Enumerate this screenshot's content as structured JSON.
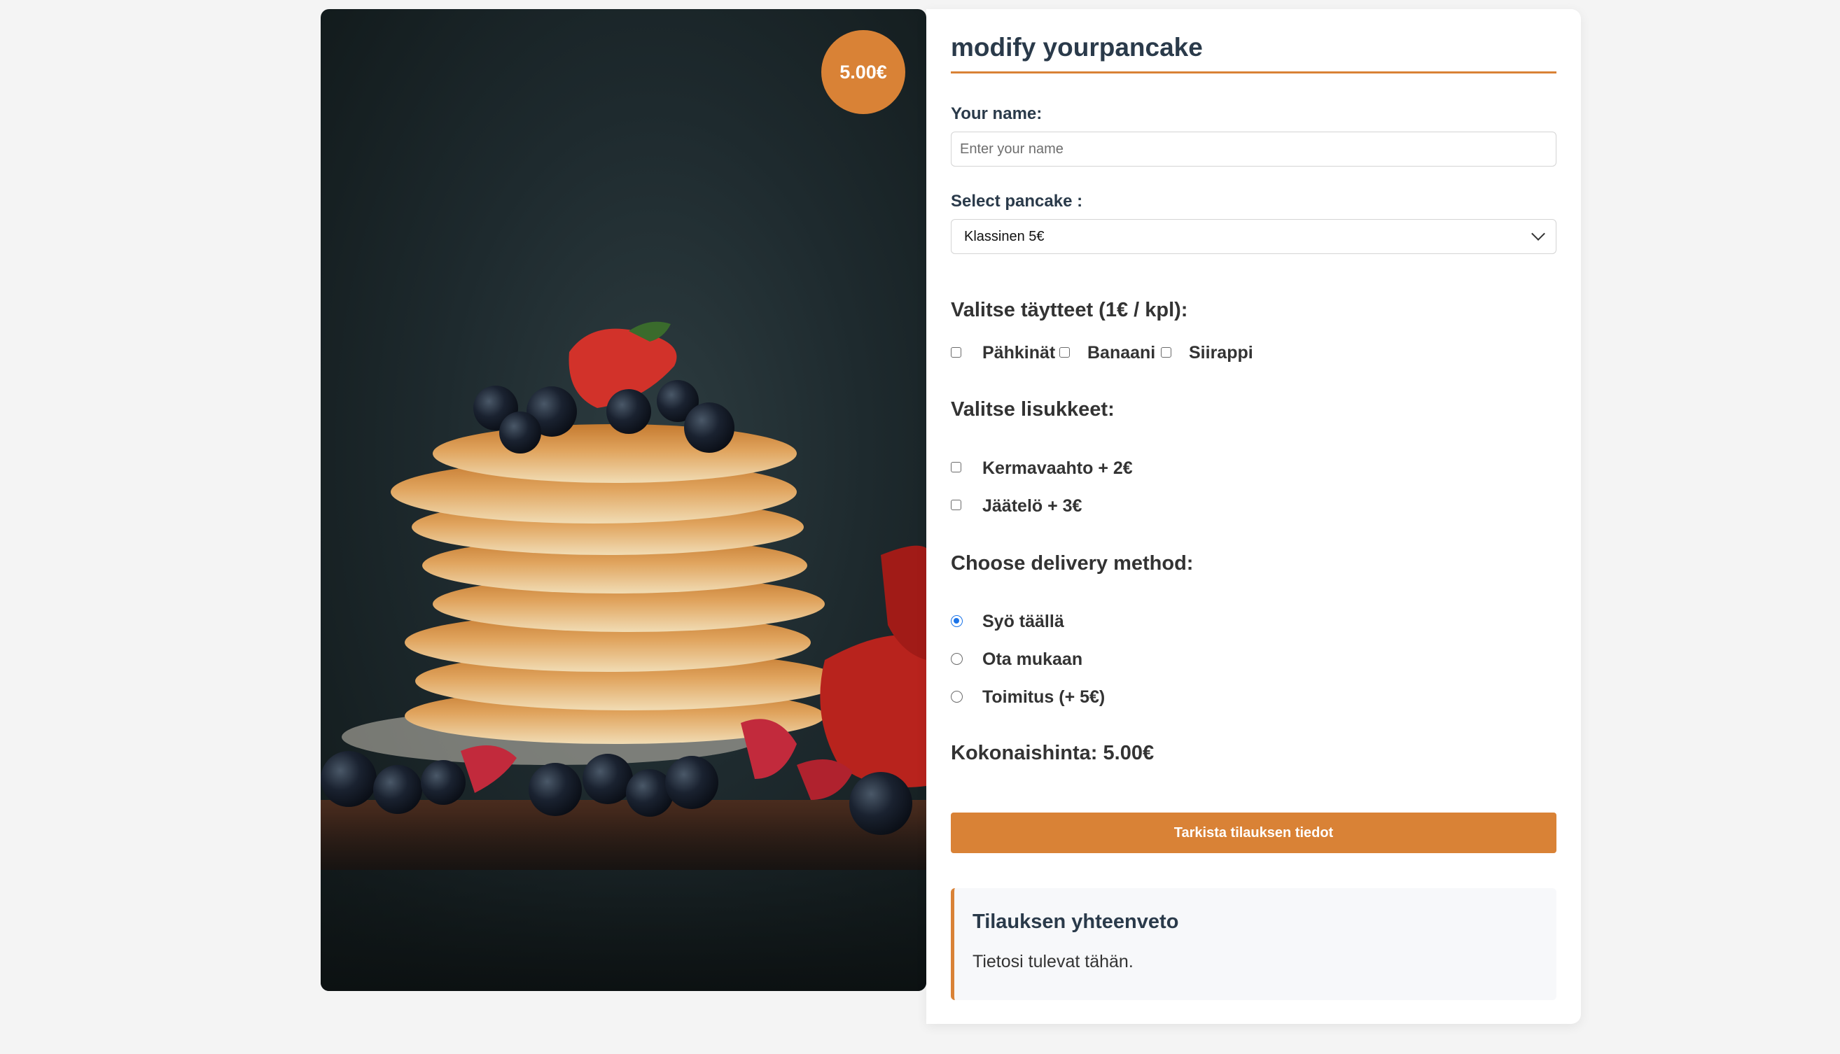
{
  "image_panel": {
    "price_badge": "5.00€"
  },
  "form": {
    "title": "modify yourpancake",
    "name_label": "Your name:",
    "name_placeholder": "Enter your name",
    "name_value": "",
    "pancake_label": "Select pancake :",
    "pancake_selected": "Klassinen 5€",
    "toppings_heading": "Valitse täytteet (1€ / kpl):",
    "toppings": [
      {
        "label": "Pähkinät",
        "checked": false
      },
      {
        "label": "Banaani",
        "checked": false
      },
      {
        "label": "Siirappi",
        "checked": false
      }
    ],
    "extras_heading": "Valitse lisukkeet:",
    "extras": [
      {
        "label": "Kermavaahto + 2€",
        "checked": false
      },
      {
        "label": "Jäätelö + 3€",
        "checked": false
      }
    ],
    "delivery_heading": "Choose delivery method:",
    "delivery_options": [
      {
        "label": "Syö täällä",
        "selected": true
      },
      {
        "label": "Ota mukaan",
        "selected": false
      },
      {
        "label": "Toimitus (+ 5€)",
        "selected": false
      }
    ],
    "total_text": "Kokonaishinta: 5.00€",
    "submit_label": "Tarkista tilauksen tiedot"
  },
  "summary": {
    "title": "Tilauksen yhteenveto",
    "text": "Tietosi tulevat tähän."
  },
  "colors": {
    "accent": "#d98236",
    "radio_selected": "#1a73e8",
    "heading_text": "#2a3a4a"
  }
}
